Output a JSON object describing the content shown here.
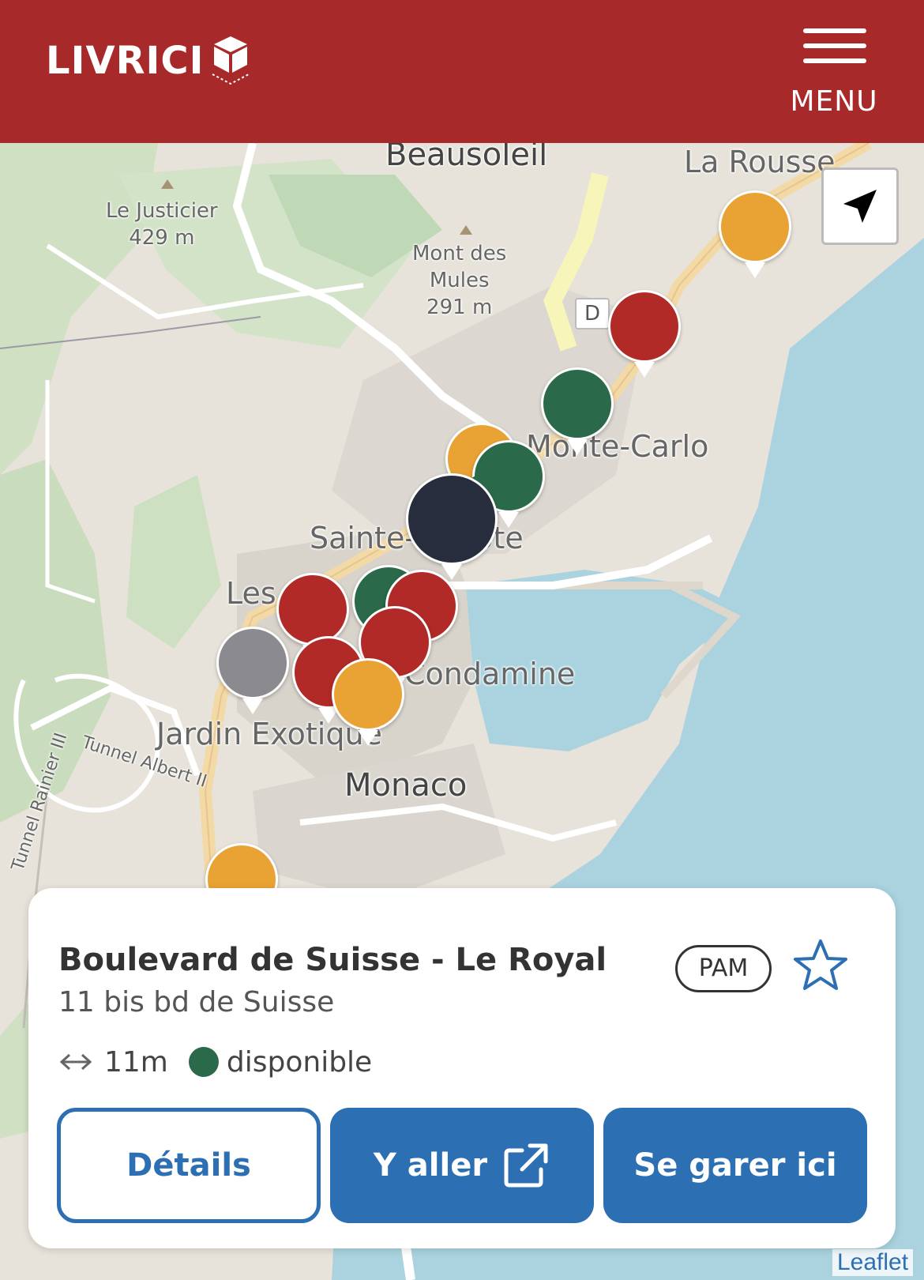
{
  "header": {
    "logo_text": "LIVRICI",
    "menu_label": "MENU"
  },
  "map": {
    "labels": {
      "beausoleil": "Beausoleil",
      "la_rousse": "La Rousse",
      "le_justicier": "Le Justicier",
      "le_justicier_alt": "429 m",
      "mont_des_mules": "Mont des",
      "mont_des_mules_2": "Mules",
      "mont_des_mules_alt": "291 m",
      "monte_carlo": "Monte-Carlo",
      "sainte_devote": "Sainte-Dévote",
      "les": "Les",
      "condamine": "Condamine",
      "jardin_exotique": "Jardin Exotique",
      "monaco": "Monaco",
      "tunnel_albert": "Tunnel Albert II",
      "tunnel_rainier": "Tunnel Rainier III",
      "d_sign": "D"
    },
    "markers": [
      {
        "status": "orange"
      },
      {
        "status": "red"
      },
      {
        "status": "green"
      },
      {
        "status": "orange"
      },
      {
        "status": "green"
      },
      {
        "status": "selected"
      },
      {
        "status": "red"
      },
      {
        "status": "green"
      },
      {
        "status": "red"
      },
      {
        "status": "red"
      },
      {
        "status": "grey"
      },
      {
        "status": "red"
      },
      {
        "status": "orange"
      },
      {
        "status": "orange"
      }
    ],
    "attribution": "Leaflet"
  },
  "card": {
    "title": "Boulevard de Suisse - Le Royal",
    "address": "11 bis bd de Suisse",
    "badge": "PAM",
    "distance": "11m",
    "status": "disponible",
    "buttons": {
      "details": "Détails",
      "go": "Y aller",
      "park": "Se garer ici"
    }
  },
  "colors": {
    "header": "#a8292a",
    "red": "#b12a27",
    "green": "#2a6a4a",
    "orange": "#e9a234",
    "grey": "#8b8a8e",
    "selected": "#282d3d",
    "primary": "#2d6fb3"
  }
}
